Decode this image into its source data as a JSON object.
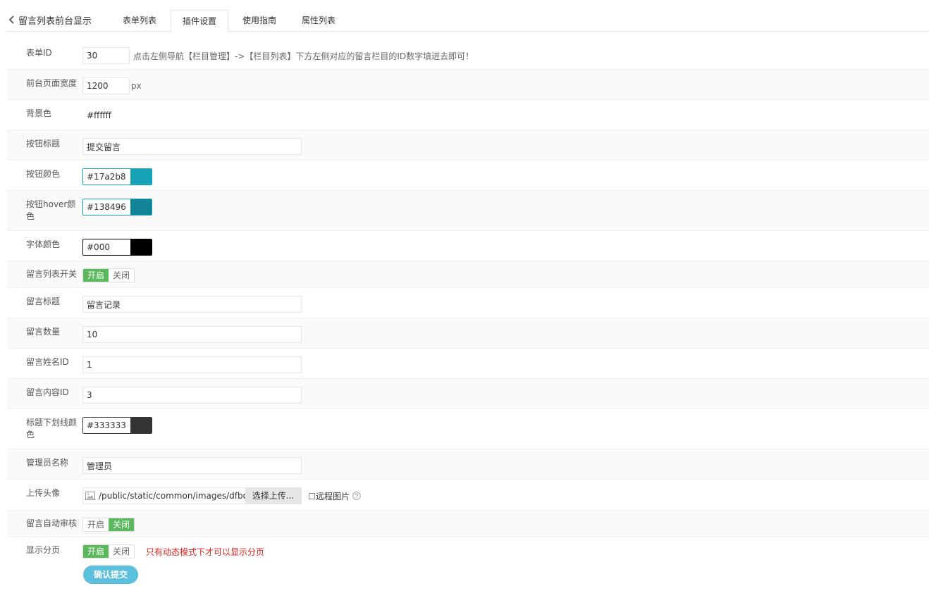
{
  "header": {
    "back_label": "留言列表前台显示",
    "tabs": [
      {
        "label": "表单列表",
        "active": false
      },
      {
        "label": "插件设置",
        "active": true
      },
      {
        "label": "使用指南",
        "active": false
      },
      {
        "label": "属性列表",
        "active": false
      }
    ]
  },
  "form": {
    "form_id": {
      "label": "表单ID",
      "value": "30",
      "hint": "点击左侧导航【栏目管理】->【栏目列表】下方左侧对应的留言栏目的ID数字填进去即可！"
    },
    "page_width": {
      "label": "前台页面宽度",
      "value": "1200",
      "unit": "px"
    },
    "bg_color": {
      "label": "背景色",
      "value": "#ffffff"
    },
    "button_title": {
      "label": "按钮标题",
      "value": "提交留言"
    },
    "button_color": {
      "label": "按钮颜色",
      "value": "#17a2b8",
      "swatch": "#17a2b8"
    },
    "button_hover_color": {
      "label": "按钮hover颜色",
      "value": "#138496",
      "swatch": "#138496"
    },
    "font_color": {
      "label": "字体颜色",
      "value": "#000",
      "swatch": "#000000"
    },
    "list_switch": {
      "label": "留言列表开关",
      "on": "开启",
      "off": "关闭",
      "selected": "on"
    },
    "message_title": {
      "label": "留言标题",
      "value": "留言记录"
    },
    "message_count": {
      "label": "留言数量",
      "value": "10"
    },
    "name_id": {
      "label": "留言姓名ID",
      "value": "1"
    },
    "content_id": {
      "label": "留言内容ID",
      "value": "3"
    },
    "title_underline_color": {
      "label": "标题下划线颜色",
      "value": "#333333",
      "swatch": "#333333"
    },
    "admin_name": {
      "label": "管理员名称",
      "value": "管理员"
    },
    "avatar": {
      "label": "上传头像",
      "path": "/public/static/common/images/dfboy.png",
      "button": "选择上传...",
      "remote_label": "远程图片"
    },
    "auto_review": {
      "label": "留言自动审核",
      "on": "开启",
      "off": "关闭",
      "selected": "off"
    },
    "pagination": {
      "label": "显示分页",
      "on": "开启",
      "off": "关闭",
      "selected": "on",
      "hint": "只有动态模式下才可以显示分页"
    }
  },
  "submit_label": "确认提交",
  "colors": {
    "accent": "#17a2b8",
    "switch_on": "#5cb85c",
    "submit": "#5bc0de",
    "warning": "#d9231b"
  }
}
